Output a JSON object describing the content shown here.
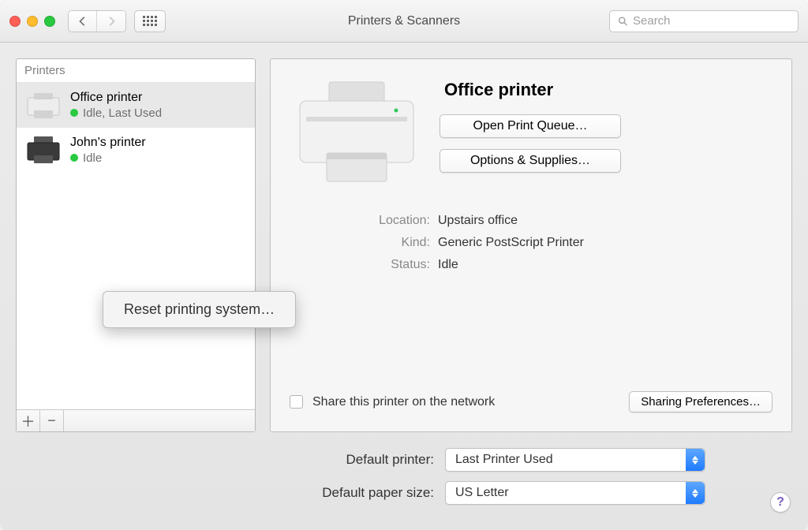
{
  "window_title": "Printers & Scanners",
  "search_placeholder": "Search",
  "sidebar": {
    "header": "Printers",
    "printers": [
      {
        "name": "Office printer",
        "status": "Idle, Last Used",
        "selected": true,
        "variant": "light"
      },
      {
        "name": "John's printer",
        "status": "Idle",
        "selected": false,
        "variant": "dark"
      }
    ]
  },
  "context_menu": {
    "reset_label": "Reset printing system…"
  },
  "details": {
    "title": "Office printer",
    "open_queue": "Open Print Queue…",
    "options_supplies": "Options & Supplies…",
    "rows": {
      "location_label": "Location:",
      "location_value": "Upstairs office",
      "kind_label": "Kind:",
      "kind_value": "Generic PostScript Printer",
      "status_label": "Status:",
      "status_value": "Idle"
    },
    "share_label": "Share this printer on the network",
    "sharing_prefs": "Sharing Preferences…"
  },
  "bottom": {
    "default_printer_label": "Default printer:",
    "default_printer_value": "Last Printer Used",
    "default_paper_label": "Default paper size:",
    "default_paper_value": "US Letter"
  },
  "help_glyph": "?"
}
